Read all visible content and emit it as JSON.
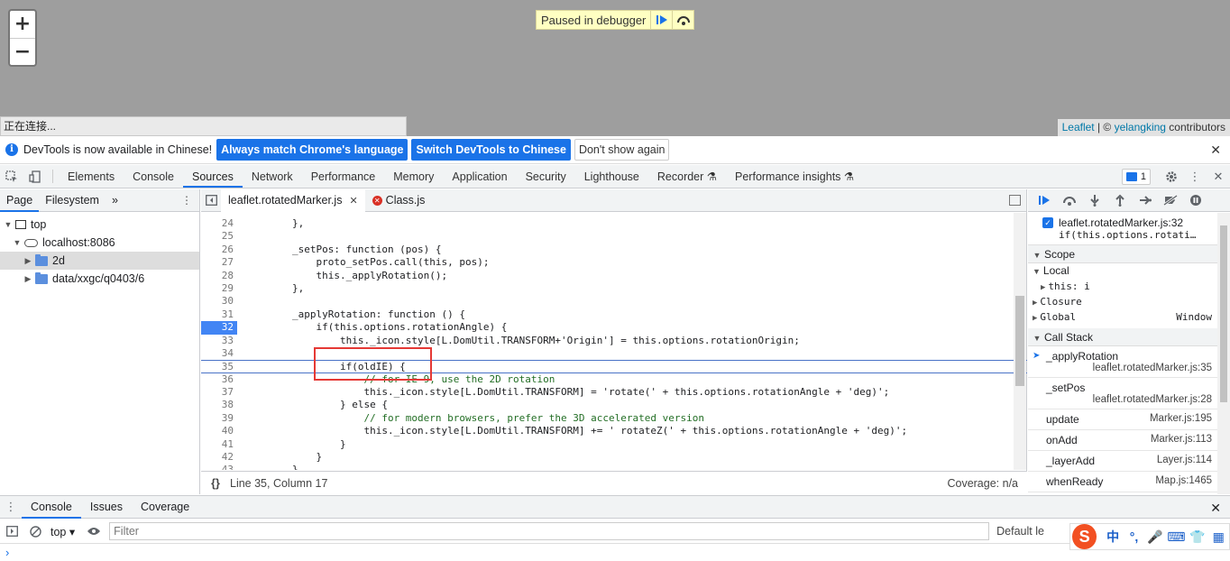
{
  "map": {
    "zoom_in": "+",
    "zoom_out": "−",
    "paused_text": "Paused in debugger",
    "connecting_text": "正在连接...",
    "attribution_link1": "Leaflet",
    "attribution_sep": " | © ",
    "attribution_link2": "yelangking",
    "attribution_suffix": " contributors"
  },
  "infobar": {
    "text": "DevTools is now available in Chinese!",
    "btn_match": "Always match Chrome's language",
    "btn_switch": "Switch DevTools to Chinese",
    "btn_dont_show": "Don't show again"
  },
  "toolbar": {
    "tabs": [
      "Elements",
      "Console",
      "Sources",
      "Network",
      "Performance",
      "Memory",
      "Application",
      "Security",
      "Lighthouse",
      "Recorder",
      "Performance insights"
    ],
    "active_tab": "Sources",
    "issues_count": "1"
  },
  "navigator": {
    "tabs": [
      "Page",
      "Filesystem"
    ],
    "more": "»",
    "tree": [
      {
        "label": "top"
      },
      {
        "label": "localhost:8086"
      },
      {
        "label": "2d"
      },
      {
        "label": "data/xxgc/q0403/6"
      }
    ]
  },
  "editor": {
    "tabs": [
      {
        "label": "leaflet.rotatedMarker.js"
      },
      {
        "label": "Class.js"
      }
    ],
    "status_position": "Line 35, Column 17",
    "status_coverage": "Coverage: n/a",
    "braces": "{}",
    "lines": [
      {
        "n": "24",
        "t": "        },"
      },
      {
        "n": "25",
        "t": ""
      },
      {
        "n": "26",
        "t": "        _setPos: function (pos) {"
      },
      {
        "n": "27",
        "t": "            proto_setPos.call(this, pos);"
      },
      {
        "n": "28",
        "t": "            this._applyRotation();"
      },
      {
        "n": "29",
        "t": "        },"
      },
      {
        "n": "30",
        "t": ""
      },
      {
        "n": "31",
        "t": "        _applyRotation: function () {"
      },
      {
        "n": "32",
        "t": "            if(this.options.rotationAngle) {"
      },
      {
        "n": "33",
        "t": "                this._icon.style[L.DomUtil.TRANSFORM+'Origin'] = this.options.rotationOrigin;"
      },
      {
        "n": "34",
        "t": ""
      },
      {
        "n": "35",
        "t": "                if(oldIE) {"
      },
      {
        "n": "36",
        "t": "                    // for IE 9, use the 2D rotation"
      },
      {
        "n": "37",
        "t": "                    this._icon.style[L.DomUtil.TRANSFORM] = 'rotate(' + this.options.rotationAngle + 'deg)';"
      },
      {
        "n": "38",
        "t": "                } else {"
      },
      {
        "n": "39",
        "t": "                    // for modern browsers, prefer the 3D accelerated version"
      },
      {
        "n": "40",
        "t": "                    this._icon.style[L.DomUtil.TRANSFORM] += ' rotateZ(' + this.options.rotationAngle + 'deg)';"
      },
      {
        "n": "41",
        "t": "                }"
      },
      {
        "n": "42",
        "t": "            }"
      },
      {
        "n": "43",
        "t": "        }"
      }
    ]
  },
  "debugger": {
    "breakpoint_file": "leaflet.rotatedMarker.js:32",
    "breakpoint_code": "if(this.options.rotation…",
    "scope_title": "Scope",
    "local_title": "Local",
    "local_this": "this: i",
    "closure": "Closure",
    "global": "Global",
    "global_value": "Window",
    "callstack_title": "Call Stack",
    "frames": [
      {
        "fn": "_applyRotation",
        "loc": "leaflet.rotatedMarker.js:35"
      },
      {
        "fn": "_setPos",
        "loc": "leaflet.rotatedMarker.js:28"
      },
      {
        "fn": "update",
        "loc": "Marker.js:195"
      },
      {
        "fn": "onAdd",
        "loc": "Marker.js:113"
      },
      {
        "fn": "_layerAdd",
        "loc": "Layer.js:114"
      },
      {
        "fn": "whenReady",
        "loc": "Map.js:1465"
      }
    ]
  },
  "drawer": {
    "tabs": [
      "Console",
      "Issues",
      "Coverage"
    ],
    "context": "top",
    "filter_placeholder": "Filter",
    "levels": "Default le",
    "prompt": "›"
  },
  "ime": {
    "logo": "S",
    "items": [
      "中",
      "°,",
      "🎤",
      "⌨",
      "👕",
      "▦"
    ]
  }
}
